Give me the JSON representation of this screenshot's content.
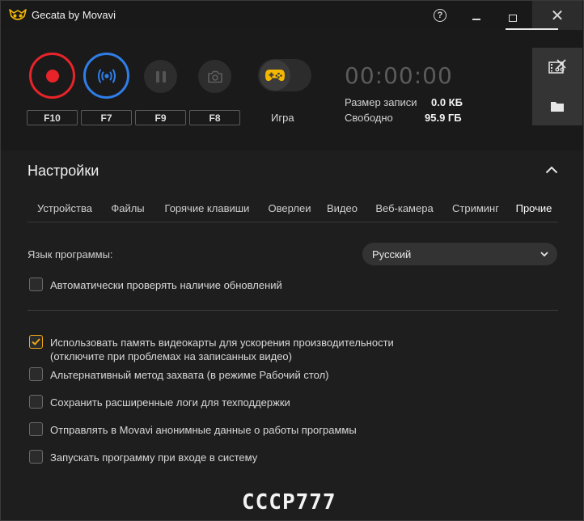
{
  "titlebar": {
    "title": "Gecata by Movavi",
    "help_label": "?",
    "close_label": "✕"
  },
  "controls": {
    "hotkeys": {
      "record": "F10",
      "stream": "F7",
      "pause": "F9",
      "screenshot": "F8"
    },
    "game_mode_label": "Игра",
    "timer": "00:00:00",
    "record_size_label": "Размер записи",
    "record_size_value": "0.0 КБ",
    "free_space_label": "Свободно",
    "free_space_value": "95.9 ГБ"
  },
  "settings": {
    "title": "Настройки",
    "tabs": [
      {
        "label": "Устройства"
      },
      {
        "label": "Файлы"
      },
      {
        "label": "Горячие клавиши"
      },
      {
        "label": "Оверлеи"
      },
      {
        "label": "Видео"
      },
      {
        "label": "Веб-камера"
      },
      {
        "label": "Стриминг"
      },
      {
        "label": "Прочие",
        "active": true
      }
    ],
    "language_label": "Язык программы:",
    "language_value": "Русский",
    "auto_update": {
      "label": "Автоматически проверять наличие обновлений",
      "checked": false
    },
    "options": [
      {
        "line1": "Использовать память видеокарты для ускорения производительности",
        "line2": "(отключите при проблемах на записанных видео)",
        "checked": true
      },
      {
        "line1": "Альтернативный метод захвата (в режиме Рабочий стол)",
        "checked": false
      },
      {
        "line1": "Сохранить расширенные логи для техподдержки",
        "checked": false
      },
      {
        "line1": "Отправлять в Movavi анонимные данные о работы программы",
        "checked": false
      },
      {
        "line1": "Запускать программу при входе в систему",
        "checked": false
      }
    ]
  },
  "watermark": "CCCP777",
  "colors": {
    "record_accent": "#e8242a",
    "stream_accent": "#2f7ee8",
    "game_icon": "#f5b800",
    "checkbox_checked": "#f0a818"
  },
  "icons": {
    "app_logo": "owl-logo-icon",
    "record": "record-dot-icon",
    "stream": "broadcast-icon",
    "pause": "pause-icon",
    "screenshot": "camera-icon",
    "game": "gamepad-icon",
    "editor": "film-edit-icon",
    "folder": "folder-icon",
    "collapse": "chevron-up-icon",
    "dropdown": "chevron-down-icon",
    "check": "checkmark-icon"
  }
}
